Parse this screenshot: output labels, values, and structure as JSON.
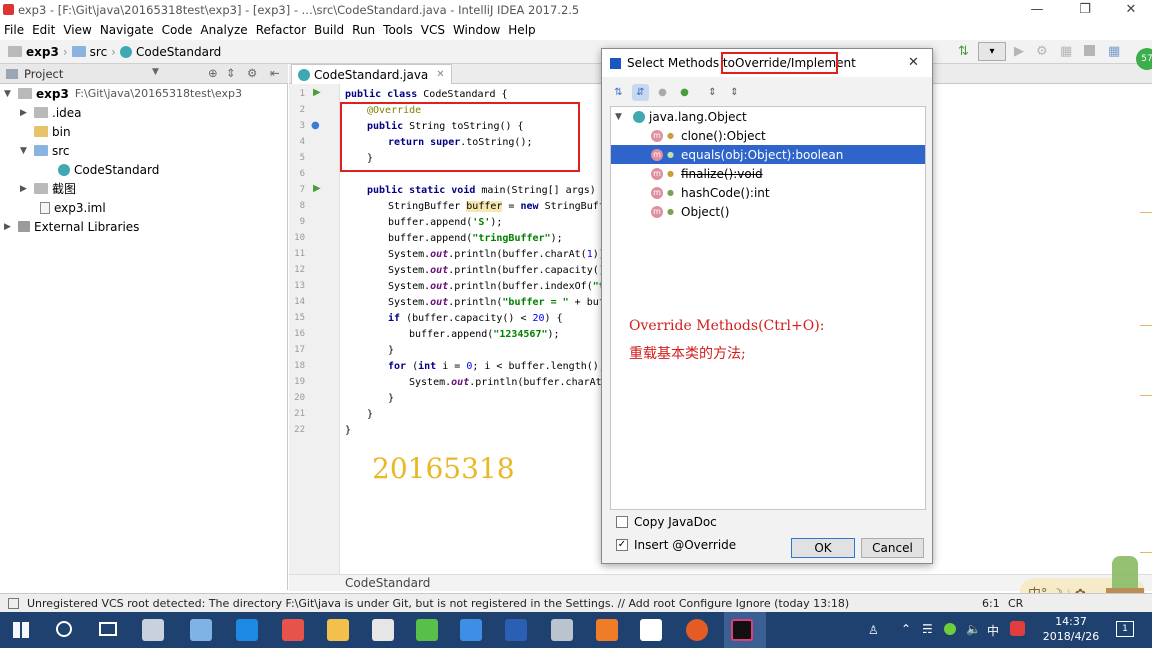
{
  "window": {
    "title": "exp3 - [F:\\Git\\java\\20165318test\\exp3] - [exp3] - ...\\src\\CodeStandard.java - IntelliJ IDEA 2017.2.5"
  },
  "menu": [
    "File",
    "Edit",
    "View",
    "Navigate",
    "Code",
    "Analyze",
    "Refactor",
    "Build",
    "Run",
    "Tools",
    "VCS",
    "Window",
    "Help"
  ],
  "breadcrumb": {
    "project": "exp3",
    "folder": "src",
    "file": "CodeStandard"
  },
  "project_panel": {
    "header": "Project",
    "root_name": "exp3",
    "root_path": "F:\\Git\\java\\20165318test\\exp3",
    "items": [
      ".idea",
      "bin",
      "src",
      "CodeStandard",
      "截图",
      "exp3.iml",
      "External Libraries"
    ]
  },
  "editor": {
    "tab": "CodeStandard.java",
    "line_numbers": [
      "1",
      "2",
      "3",
      "4",
      "5",
      "6",
      "7",
      "8",
      "9",
      "10",
      "11",
      "12",
      "13",
      "14",
      "15",
      "16",
      "17",
      "18",
      "19",
      "20",
      "21",
      "22"
    ],
    "breadcrumb": "CodeStandard",
    "watermark": "20165318"
  },
  "code": {
    "l1a": "public class ",
    "l1b": "CodeStandard {",
    "l2": "@Override",
    "l3a": "public ",
    "l3b": "String toString() {",
    "l4a": "return super",
    ".l4b": "",
    "l4b": ".toString();",
    "l5": "}",
    "l7a": "public static void ",
    "l7b": "main(String[] args) {",
    "l8a": "StringBuffer ",
    "l8b": "buffer",
    " l8c": "",
    "l8c": " = ",
    "l8d": "new ",
    "l8e": "StringBuffer(",
    "l9a": "buffer.append(",
    "l9b": "'S'",
    "l9c": ");",
    "l10a": "buffer.append(",
    "l10b": "\"tringBuffer\"",
    "l10c": ");",
    "l11a": "System.",
    "l11b": "out",
    ".l11c": "",
    "l11c": ".println(buffer.charAt(",
    "l11d": "1",
    "l11e": "));",
    "l12a": "System.",
    "l12b": "out",
    "l12c": ".println(buffer.capacity());",
    "l13a": "System.",
    "l13b": "out",
    "l13c": ".println(buffer.indexOf(",
    "l13d": "\"trin",
    "l14a": "System.",
    "l14b": "out",
    "l14c": ".println(",
    "l14d": "\"buffer = \"",
    "l14e": " + buffe",
    "l15a": "if ",
    "l15b": "(buffer.capacity() < ",
    "l15c": "20",
    "l15d": ") {",
    "l16a": "buffer.append(",
    "l16b": "\"1234567\"",
    "l16c": ");",
    "l17": "}",
    "l18a": "for ",
    "l18b": "(",
    "l18c": "int ",
    "l18d": "i = ",
    "l18e": "0",
    "l18f": "; i < buffer.length(); i+",
    "l19a": "System.",
    "l19b": "out",
    "l19c": ".println(buffer.charAt(i)",
    "l20": "}",
    "l21": "}",
    "l22": "}"
  },
  "dialog": {
    "title_prefix": "Select Methods to ",
    "title_highlight": "Override/Implement",
    "close": "✕",
    "root": "java.lang.Object",
    "methods": [
      "clone():Object",
      "equals(obj:Object):boolean",
      "finalize():void",
      "hashCode():int",
      "Object()"
    ],
    "note1": "Override Methods(Ctrl+O):",
    "note2": "重载基本类的方法;",
    "copy_javadoc": "Copy JavaDoc",
    "insert_override": "Insert @Override",
    "ok": "OK",
    "cancel": "Cancel"
  },
  "status": {
    "message": "Unregistered VCS root detected: The directory F:\\Git\\java is under Git, but is not registered in the Settings. // Add root  Configure  Ignore (today 13:18)",
    "position": "6:1",
    "encoding": "CR"
  },
  "clock": {
    "time": "14:37",
    "date": "2018/4/26"
  },
  "tray_text": "中°,☽☕✿",
  "ime": "中",
  "notification_count": "1",
  "side_badge": "57"
}
